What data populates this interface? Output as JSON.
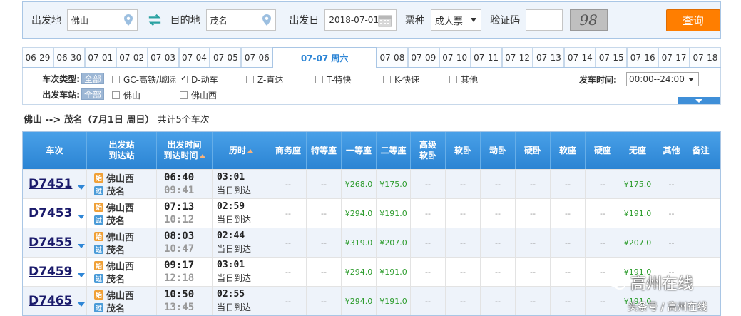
{
  "search": {
    "from_label": "出发地",
    "from_value": "佛山",
    "to_label": "目的地",
    "to_value": "茂名",
    "date_label": "出发日",
    "date_value": "2018-07-01",
    "ticket_label": "票种",
    "ticket_value": "成人票",
    "captcha_label": "验证码",
    "captcha_text": "98",
    "query_button": "查询"
  },
  "date_tabs": [
    "06-29",
    "06-30",
    "07-01",
    "07-02",
    "07-03",
    "07-04",
    "07-05",
    "07-06",
    "07-07 周六",
    "07-08",
    "07-09",
    "07-10",
    "07-11",
    "07-12",
    "07-13",
    "07-14",
    "07-15",
    "07-16",
    "07-17",
    "07-18"
  ],
  "filter": {
    "type_label": "车次类型:",
    "all_label": "全部",
    "types": [
      {
        "label": "GC-高铁/城际",
        "checked": false
      },
      {
        "label": "D-动车",
        "checked": true
      },
      {
        "label": "Z-直达",
        "checked": false
      },
      {
        "label": "T-特快",
        "checked": false
      },
      {
        "label": "K-快速",
        "checked": false
      },
      {
        "label": "其他",
        "checked": false
      }
    ],
    "depart_time_label": "发车时间:",
    "depart_time_value": "00:00--24:00",
    "station_label": "出发车站:",
    "stations": [
      {
        "label": "佛山",
        "checked": false
      },
      {
        "label": "佛山西",
        "checked": false
      }
    ]
  },
  "summary": {
    "route": "佛山 --> 茂名（7月1日 周日）",
    "count_text": "共计5个车次"
  },
  "table": {
    "headers": {
      "train": "车次",
      "stations_1": "出发站",
      "stations_2": "到达站",
      "times_1": "出发时间",
      "times_2": "到达时间",
      "duration": "历时",
      "business": "商务座",
      "special": "特等座",
      "first": "一等座",
      "second": "二等座",
      "soft_sleeper_1": "高级",
      "soft_sleeper_2": "软卧",
      "soft_sleep": "软卧",
      "moving_sleep": "动卧",
      "hard_sleep": "硬卧",
      "soft_seat": "软座",
      "hard_seat": "硬座",
      "no_seat": "无座",
      "other": "其他",
      "remark": "备注"
    },
    "start_icon": "始",
    "pass_icon": "过",
    "rows": [
      {
        "train": "D7451",
        "from": "佛山西",
        "to": "茂名",
        "dep": "06:40",
        "arr": "09:41",
        "dur": "03:01",
        "arrive_note": "当日到达",
        "business": "--",
        "special": "--",
        "first": "¥268.0",
        "second": "¥175.0",
        "high_soft": "--",
        "soft_sleep": "--",
        "moving_sleep": "--",
        "hard_sleep": "--",
        "soft_seat": "--",
        "hard_seat": "--",
        "no_seat": "¥175.0",
        "other": "--"
      },
      {
        "train": "D7453",
        "from": "佛山西",
        "to": "茂名",
        "dep": "07:13",
        "arr": "10:12",
        "dur": "02:59",
        "arrive_note": "当日到达",
        "business": "--",
        "special": "--",
        "first": "¥294.0",
        "second": "¥191.0",
        "high_soft": "--",
        "soft_sleep": "--",
        "moving_sleep": "--",
        "hard_sleep": "--",
        "soft_seat": "--",
        "hard_seat": "--",
        "no_seat": "¥191.0",
        "other": "--"
      },
      {
        "train": "D7455",
        "from": "佛山西",
        "to": "茂名",
        "dep": "08:03",
        "arr": "10:47",
        "dur": "02:44",
        "arrive_note": "当日到达",
        "business": "--",
        "special": "--",
        "first": "¥319.0",
        "second": "¥207.0",
        "high_soft": "--",
        "soft_sleep": "--",
        "moving_sleep": "--",
        "hard_sleep": "--",
        "soft_seat": "--",
        "hard_seat": "--",
        "no_seat": "¥207.0",
        "other": "--"
      },
      {
        "train": "D7459",
        "from": "佛山西",
        "to": "茂名",
        "dep": "09:17",
        "arr": "12:18",
        "dur": "03:01",
        "arrive_note": "当日到达",
        "business": "--",
        "special": "--",
        "first": "¥294.0",
        "second": "¥191.0",
        "high_soft": "--",
        "soft_sleep": "--",
        "moving_sleep": "--",
        "hard_sleep": "--",
        "soft_seat": "--",
        "hard_seat": "--",
        "no_seat": "¥191.0",
        "other": "--"
      },
      {
        "train": "D7465",
        "from": "佛山西",
        "to": "茂名",
        "dep": "10:50",
        "arr": "13:45",
        "dur": "02:55",
        "arrive_note": "当日到达",
        "business": "--",
        "special": "--",
        "first": "¥294.0",
        "second": "¥191.0",
        "high_soft": "--",
        "soft_sleep": "--",
        "moving_sleep": "--",
        "hard_sleep": "--",
        "soft_seat": "--",
        "hard_seat": "--",
        "no_seat": "¥191.0",
        "other": "--"
      }
    ]
  },
  "watermark": {
    "main": "高州在线",
    "sub": "头条号 / 高州在线"
  },
  "colors": {
    "accent": "#2e86d6",
    "price": "#2d9c2d",
    "query_button": "#ff7e00",
    "header_bg": "#3a92dd"
  }
}
